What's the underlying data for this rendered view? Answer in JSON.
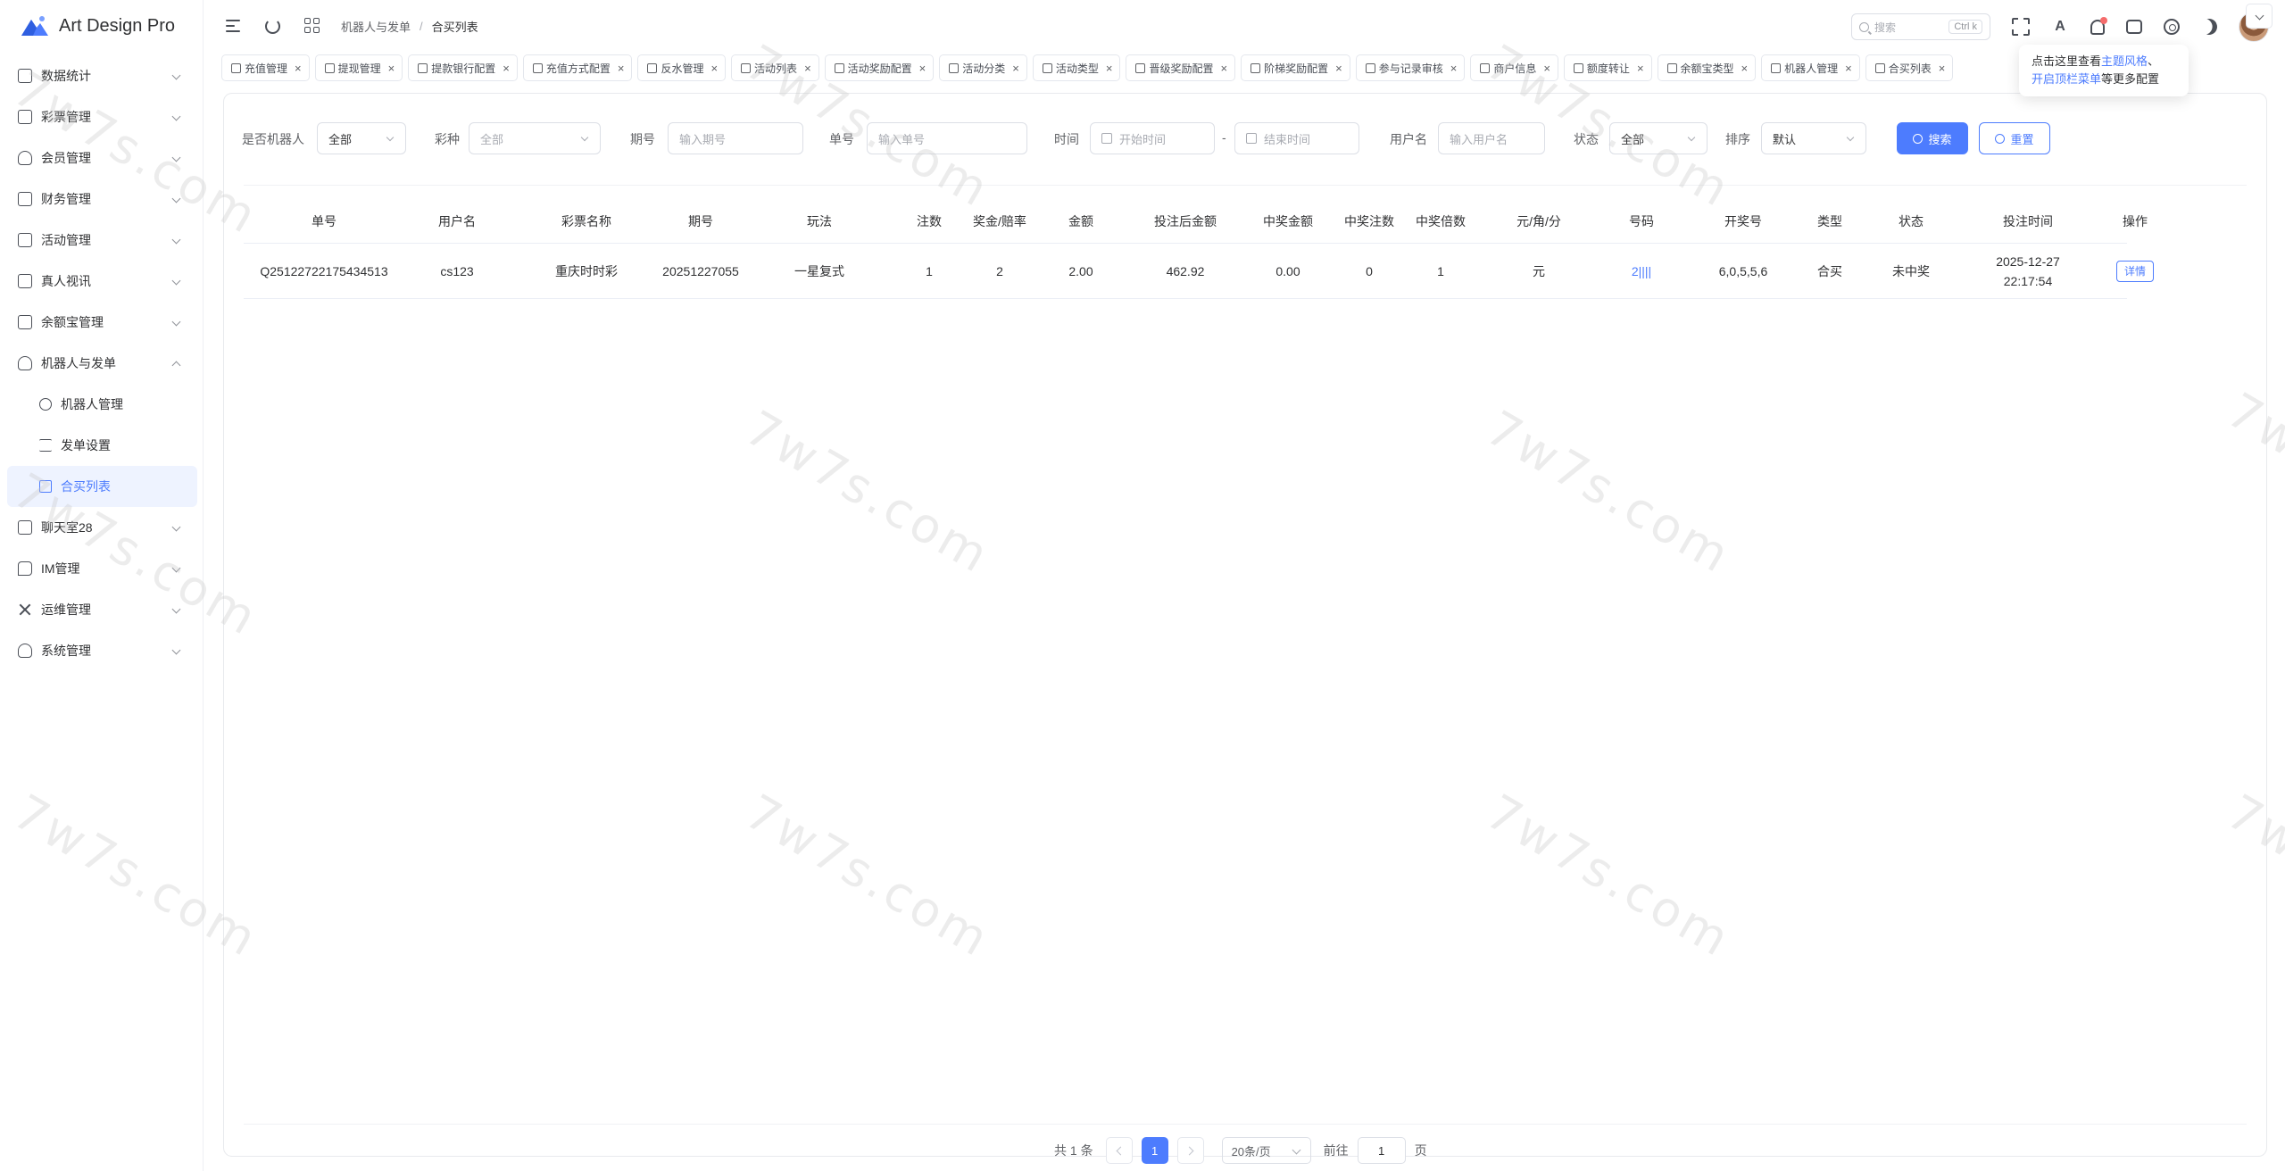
{
  "app": {
    "title": "Art Design Pro",
    "brand_color": "#4d7cfe"
  },
  "sidebar": {
    "items": [
      {
        "label": "数据统计",
        "icon": "chart-icon"
      },
      {
        "label": "彩票管理",
        "icon": "ticket-icon"
      },
      {
        "label": "会员管理",
        "icon": "user-icon"
      },
      {
        "label": "财务管理",
        "icon": "wallet-icon"
      },
      {
        "label": "活动管理",
        "icon": "gift-icon"
      },
      {
        "label": "真人视讯",
        "icon": "gamepad-icon"
      },
      {
        "label": "余额宝管理",
        "icon": "safe-icon"
      },
      {
        "label": "机器人与发单",
        "icon": "robot-icon"
      }
    ],
    "subitems": [
      {
        "label": "机器人管理",
        "icon": "gear-icon"
      },
      {
        "label": "发单设置",
        "icon": "list-icon"
      },
      {
        "label": "合买列表",
        "icon": "document-icon"
      }
    ],
    "items_after": [
      {
        "label": "聊天室28",
        "icon": "chat-icon"
      },
      {
        "label": "IM管理",
        "icon": "message-icon"
      },
      {
        "label": "运维管理",
        "icon": "tools-icon"
      },
      {
        "label": "系统管理",
        "icon": "user-icon"
      }
    ]
  },
  "header": {
    "breadcrumb": [
      "机器人与发单",
      "合买列表"
    ],
    "search_placeholder": "搜索",
    "search_shortcut": "Ctrl k"
  },
  "tabs": [
    "充值管理",
    "提现管理",
    "提款银行配置",
    "充值方式配置",
    "反水管理",
    "活动列表",
    "活动奖励配置",
    "活动分类",
    "活动类型",
    "晋级奖励配置",
    "阶梯奖励配置",
    "参与记录审核",
    "商户信息",
    "额度转让",
    "余额宝类型",
    "机器人管理",
    "合买列表"
  ],
  "tooltip": {
    "line1_prefix": "点击这里查看",
    "line1_link": "主题风格",
    "line1_suffix": "、",
    "line2_link": "开启顶栏菜单",
    "line2_suffix": "等更多配置"
  },
  "filters": {
    "robot_label": "是否机器人",
    "robot_value": "全部",
    "lottery_label": "彩种",
    "lottery_placeholder": "全部",
    "issue_label": "期号",
    "issue_placeholder": "输入期号",
    "order_label": "单号",
    "order_placeholder": "输入单号",
    "time_label": "时间",
    "start_placeholder": "开始时间",
    "range_sep": "-",
    "end_placeholder": "结束时间",
    "user_label": "用户名",
    "user_placeholder": "输入用户名",
    "status_label": "状态",
    "status_value": "全部",
    "sort_label": "排序",
    "sort_value": "默认",
    "search_btn": "搜索",
    "reset_btn": "重置"
  },
  "table": {
    "headers": [
      "单号",
      "用户名",
      "彩票名称",
      "期号",
      "玩法",
      "注数",
      "奖金/赔率",
      "金额",
      "投注后金额",
      "中奖金额",
      "中奖注数",
      "中奖倍数",
      "元/角/分",
      "号码",
      "开奖号",
      "类型",
      "状态",
      "投注时间",
      "操作"
    ],
    "rows": [
      {
        "order": "Q25122722175434513",
        "user": "cs123",
        "lottery": "重庆时时彩",
        "issue": "20251227055",
        "play": "一星复式",
        "bets": "1",
        "odds": "2",
        "amount": "2.00",
        "after_amount": "462.92",
        "win_amount": "0.00",
        "win_bets": "0",
        "win_multiple": "1",
        "unit": "元",
        "number": "2||||",
        "draw": "6,0,5,5,6",
        "type": "合买",
        "status": "未中奖",
        "time_date": "2025-12-27",
        "time_clock": "22:17:54",
        "action": "详情"
      }
    ]
  },
  "pagination": {
    "total": "共 1 条",
    "current": "1",
    "page_size": "20条/页",
    "goto_label": "前往",
    "goto_value": "1",
    "page_unit": "页"
  },
  "watermark": "7w7s.com"
}
